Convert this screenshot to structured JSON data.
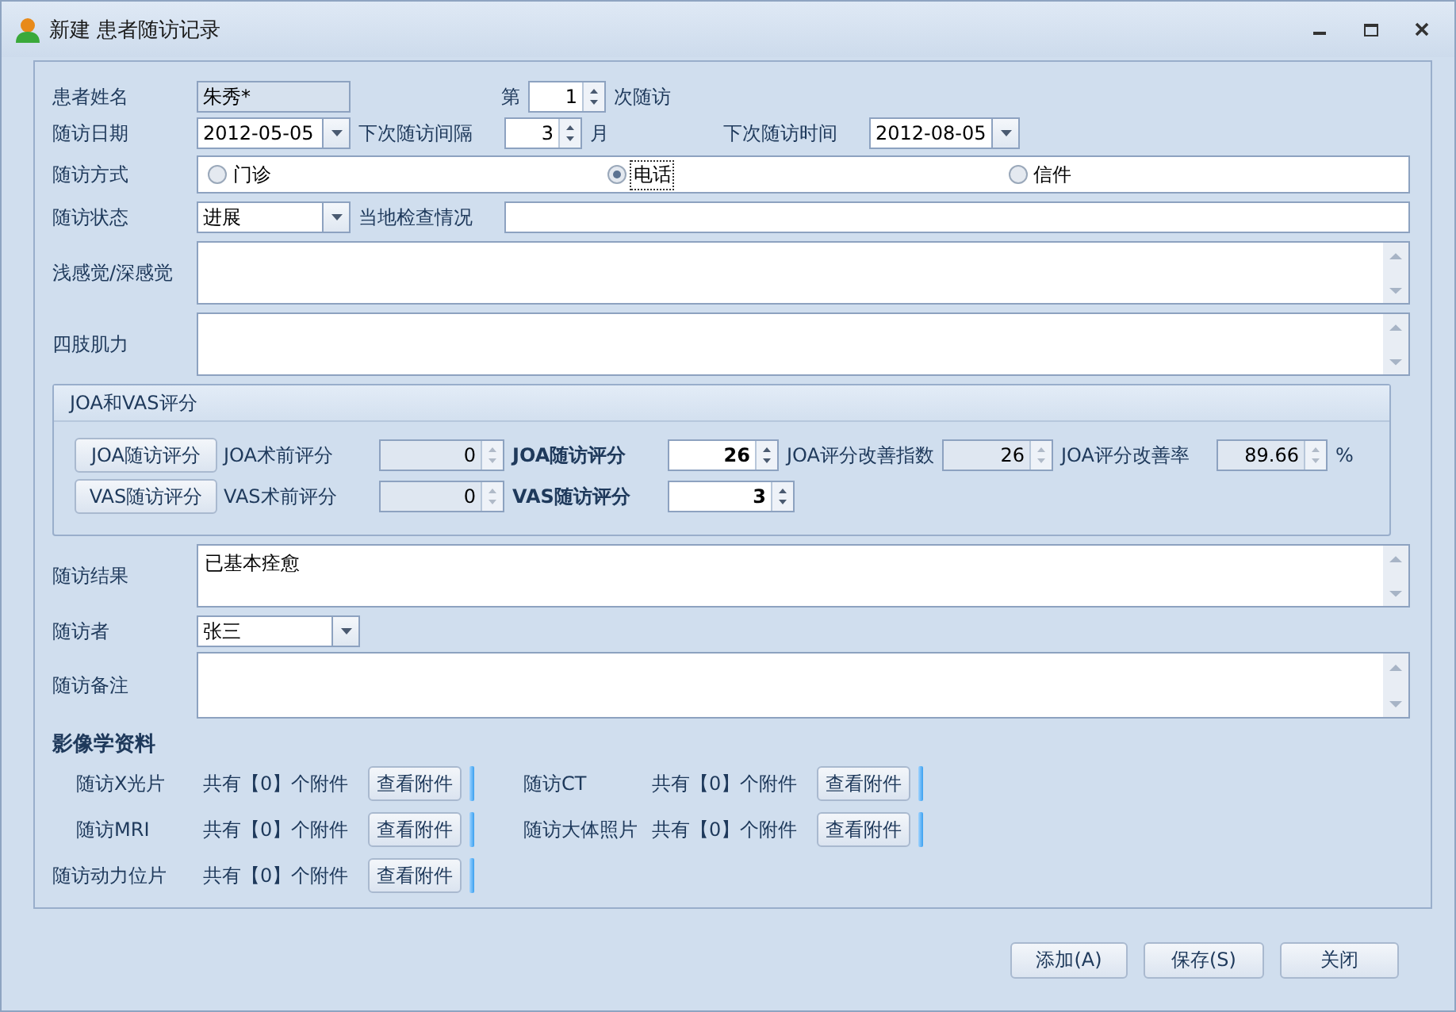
{
  "window": {
    "title": "新建 患者随访记录"
  },
  "patient_name": {
    "label": "患者姓名",
    "value": "朱秀*"
  },
  "visit_number": {
    "prefix": "第",
    "value": "1",
    "suffix": "次随访"
  },
  "visit_date": {
    "label": "随访日期",
    "value": "2012-05-05"
  },
  "interval": {
    "label": "下次随访间隔",
    "value": "3",
    "unit": "月"
  },
  "next_date": {
    "label": "下次随访时间",
    "value": "2012-08-05"
  },
  "visit_method": {
    "label": "随访方式",
    "options": [
      {
        "label": "门诊",
        "selected": false
      },
      {
        "label": "电话",
        "selected": true
      },
      {
        "label": "信件",
        "selected": false
      }
    ]
  },
  "status": {
    "label": "随访状态",
    "value": "进展"
  },
  "local_exam": {
    "label": "当地检查情况"
  },
  "sensation": {
    "label": "浅感觉/深感觉"
  },
  "strength": {
    "label": "四肢肌力"
  },
  "scores": {
    "title": "JOA和VAS评分",
    "rows": [
      {
        "button": "JOA随访评分",
        "pre_label": "JOA术前评分",
        "pre_value": "0",
        "post_label": "JOA随访评分",
        "post_value": "26",
        "extras": [
          {
            "label": "JOA评分改善指数",
            "value": "26"
          },
          {
            "label": "JOA评分改善率",
            "value": "89.66",
            "unit": "%"
          }
        ]
      },
      {
        "button": "VAS随访评分",
        "pre_label": "VAS术前评分",
        "pre_value": "0",
        "post_label": "VAS随访评分",
        "post_value": "3"
      }
    ]
  },
  "result": {
    "label": "随访结果",
    "value": "已基本痊愈"
  },
  "visitor": {
    "label": "随访者",
    "value": "张三"
  },
  "notes": {
    "label": "随访备注"
  },
  "imaging": {
    "title": "影像学资料",
    "items": [
      {
        "label": "随访X光片",
        "count": "共有【0】个附件",
        "button": "查看附件"
      },
      {
        "label": "随访CT",
        "count": "共有【0】个附件",
        "button": "查看附件"
      },
      {
        "label": "随访MRI",
        "count": "共有【0】个附件",
        "button": "查看附件"
      },
      {
        "label": "随访大体照片",
        "count": "共有【0】个附件",
        "button": "查看附件"
      },
      {
        "label": "随访动力位片",
        "count": "共有【0】个附件",
        "button": "查看附件"
      }
    ]
  },
  "footer_buttons": [
    "添加(A)",
    "保存(S)",
    "关闭"
  ]
}
